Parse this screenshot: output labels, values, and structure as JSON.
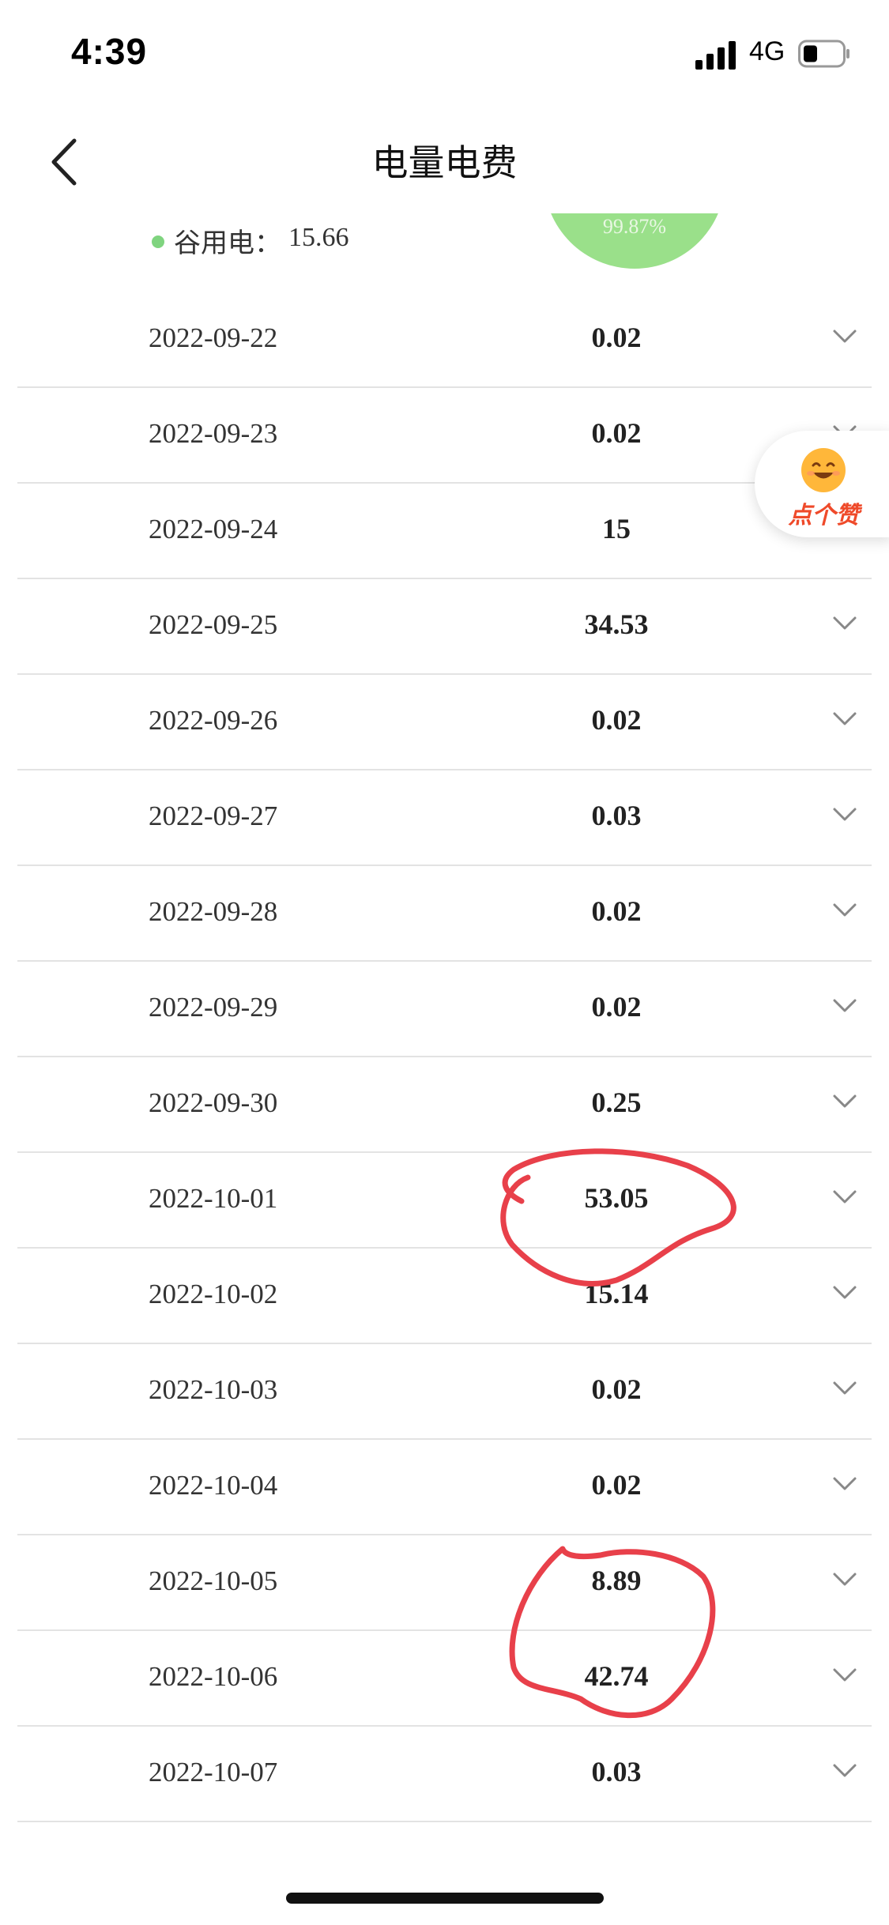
{
  "status_bar": {
    "time": "4:39",
    "network": "4G"
  },
  "nav": {
    "title": "电量电费"
  },
  "summary": {
    "valley_label": "谷用电：",
    "valley_value": "15.66",
    "pie_percent": "99.87%",
    "colors": {
      "valley": "#7fd47f",
      "pie": "#9ae08a"
    }
  },
  "rows": [
    {
      "date": "2022-09-22",
      "value": "0.02"
    },
    {
      "date": "2022-09-23",
      "value": "0.02"
    },
    {
      "date": "2022-09-24",
      "value": "15"
    },
    {
      "date": "2022-09-25",
      "value": "34.53"
    },
    {
      "date": "2022-09-26",
      "value": "0.02"
    },
    {
      "date": "2022-09-27",
      "value": "0.03"
    },
    {
      "date": "2022-09-28",
      "value": "0.02"
    },
    {
      "date": "2022-09-29",
      "value": "0.02"
    },
    {
      "date": "2022-09-30",
      "value": "0.25"
    },
    {
      "date": "2022-10-01",
      "value": "53.05"
    },
    {
      "date": "2022-10-02",
      "value": "15.14"
    },
    {
      "date": "2022-10-03",
      "value": "0.02"
    },
    {
      "date": "2022-10-04",
      "value": "0.02"
    },
    {
      "date": "2022-10-05",
      "value": "8.89"
    },
    {
      "date": "2022-10-06",
      "value": "42.74"
    },
    {
      "date": "2022-10-07",
      "value": "0.03"
    }
  ],
  "like_button": {
    "label": "点个赞",
    "color": "#ef4a2a"
  },
  "annotation_color": "#e8404a"
}
